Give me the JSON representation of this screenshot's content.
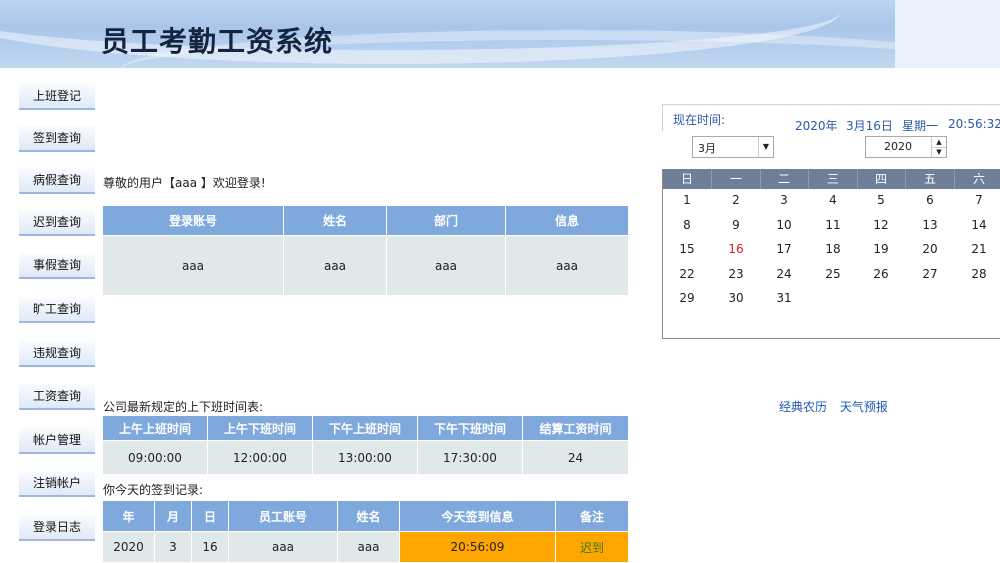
{
  "header": {
    "title": "员工考勤工资系统"
  },
  "nav": [
    "上班登记",
    "签到查询",
    "病假查询",
    "迟到查询",
    "事假查询",
    "旷工查询",
    "违规查询",
    "工资查询",
    "帐户管理",
    "注销帐户",
    "登录日志"
  ],
  "welcome": {
    "text": "尊敬的用户【aaa 】欢迎登录!"
  },
  "user_table": {
    "headers": [
      "登录账号",
      "姓名",
      "部门",
      "信息"
    ],
    "row": [
      "aaa",
      "aaa",
      "aaa",
      "aaa"
    ]
  },
  "schedule": {
    "caption": "公司最新规定的上下班时间表:",
    "headers": [
      "上午上班时间",
      "上午下班时间",
      "下午上班时间",
      "下午下班时间",
      "结算工资时间"
    ],
    "row": [
      "09:00:00",
      "12:00:00",
      "13:00:00",
      "17:30:00",
      "24"
    ]
  },
  "signin": {
    "caption": "你今天的签到记录:",
    "headers": [
      "年",
      "月",
      "日",
      "员工账号",
      "姓名",
      "今天签到信息",
      "备注"
    ],
    "row": [
      "2020",
      "3",
      "16",
      "aaa",
      "aaa",
      "20:56:09",
      "迟到"
    ]
  },
  "clock": {
    "label": "现在时间:",
    "year": "2020年",
    "date": "3月16日",
    "weekday": "星期一",
    "time": "20:56:32"
  },
  "calendar": {
    "month": "3月",
    "year": "2020",
    "weekdays": [
      "日",
      "一",
      "二",
      "三",
      "四",
      "五",
      "六"
    ],
    "weeks": [
      [
        "1",
        "2",
        "3",
        "4",
        "5",
        "6",
        "7"
      ],
      [
        "8",
        "9",
        "10",
        "11",
        "12",
        "13",
        "14"
      ],
      [
        "15",
        "16",
        "17",
        "18",
        "19",
        "20",
        "21"
      ],
      [
        "22",
        "23",
        "24",
        "25",
        "26",
        "27",
        "28"
      ],
      [
        "29",
        "30",
        "31",
        "",
        "",
        "",
        ""
      ]
    ],
    "today": "16",
    "today_color": "#e02020"
  },
  "links": [
    "经典农历",
    "天气预报"
  ],
  "colors": {
    "table_header": "#7fa8dd",
    "table_cell": "#e1e8e9",
    "highlight": "#ffa500",
    "calendar_header": "#6f7f99"
  }
}
